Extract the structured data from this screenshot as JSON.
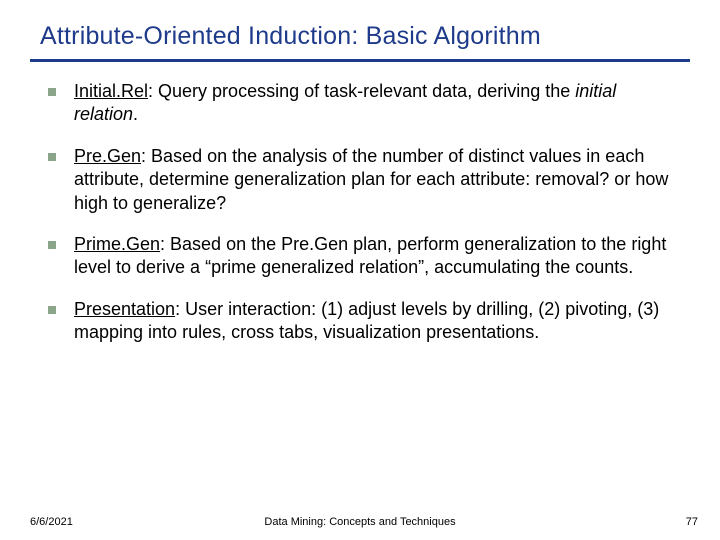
{
  "title": "Attribute-Oriented Induction: Basic Algorithm",
  "bullets": [
    {
      "term": "Initial.Rel",
      "rest_pre": ": Query processing of task-relevant data, deriving the ",
      "italic": "initial relation",
      "rest_post": "."
    },
    {
      "term": "Pre.Gen",
      "rest_pre": ":  Based on the analysis of the number of distinct values in each attribute, determine generalization plan for each attribute: removal? or how high to generalize?",
      "italic": "",
      "rest_post": ""
    },
    {
      "term": "Prime.Gen",
      "rest_pre": ": Based on the Pre.Gen plan, perform generalization to the right level to derive a “prime generalized relation”, accumulating the counts.",
      "italic": "",
      "rest_post": ""
    },
    {
      "term": "Presentation",
      "rest_pre": ": User interaction: (1) adjust levels by drilling, (2) pivoting, (3) mapping into rules, cross tabs, visualization presentations.",
      "italic": "",
      "rest_post": ""
    }
  ],
  "footer": {
    "date": "6/6/2021",
    "center": "Data Mining: Concepts and Techniques",
    "page": "77"
  }
}
